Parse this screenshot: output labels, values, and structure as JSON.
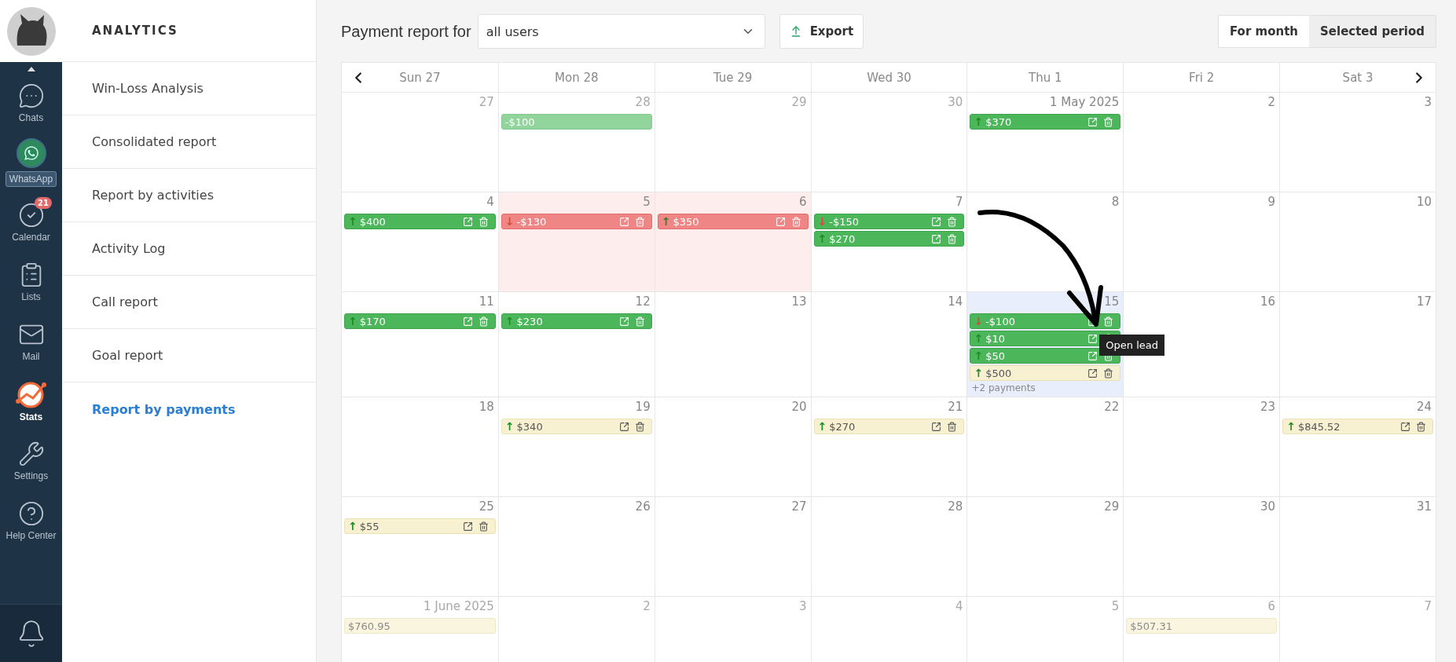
{
  "nav": {
    "items": [
      {
        "kind": "chats",
        "label": "Chats",
        "selected": false
      },
      {
        "kind": "whatsapp",
        "label": "WhatsApp",
        "selected": false
      },
      {
        "kind": "calendar",
        "label": "Calendar",
        "selected": false,
        "badge": "21"
      },
      {
        "kind": "lists",
        "label": "Lists",
        "selected": false
      },
      {
        "kind": "mail",
        "label": "Mail",
        "selected": false
      },
      {
        "kind": "stats",
        "label": "Stats",
        "selected": true
      },
      {
        "kind": "settings",
        "label": "Settings",
        "selected": false
      },
      {
        "kind": "help",
        "label": "Help Center",
        "selected": false
      }
    ]
  },
  "sidebar": {
    "title": "ANALYTICS",
    "items": [
      {
        "label": "Win-Loss Analysis",
        "selected": false
      },
      {
        "label": "Consolidated report",
        "selected": false
      },
      {
        "label": "Report by activities",
        "selected": false
      },
      {
        "label": "Activity Log",
        "selected": false
      },
      {
        "label": "Call report",
        "selected": false
      },
      {
        "label": "Goal report",
        "selected": false
      },
      {
        "label": "Report by payments",
        "selected": true
      }
    ]
  },
  "toolbar": {
    "title": "Payment report for",
    "user_select": "all users",
    "export": "Export",
    "modes": [
      {
        "label": "For month",
        "selected": true
      },
      {
        "label": "Selected period",
        "selected": false
      }
    ]
  },
  "calendar": {
    "days_header": [
      "Sun 27",
      "Mon 28",
      "Tue 29",
      "Wed 30",
      "Thu 1",
      "Fri 2",
      "Sat 3"
    ],
    "weeks": [
      {
        "days": [
          {
            "date": "27",
            "other_month": true,
            "overdue": false,
            "hovered": false
          },
          {
            "date": "28",
            "other_month": true,
            "overdue": false,
            "hovered": false,
            "payments": [
              {
                "kind": "past",
                "amount": "-$100"
              }
            ]
          },
          {
            "date": "29",
            "other_month": true,
            "overdue": false,
            "hovered": false
          },
          {
            "date": "30",
            "other_month": true,
            "overdue": false,
            "hovered": false
          },
          {
            "date": "1 May 2025",
            "other_month": false,
            "overdue": false,
            "hovered": false,
            "payments": [
              {
                "kind": "paid",
                "arrow": "↑",
                "amount": "$370"
              }
            ]
          },
          {
            "date": "2",
            "other_month": false,
            "overdue": false,
            "hovered": false
          },
          {
            "date": "3",
            "other_month": false,
            "overdue": false,
            "hovered": false
          }
        ]
      },
      {
        "days": [
          {
            "date": "4",
            "other_month": false,
            "overdue": false,
            "hovered": false,
            "payments": [
              {
                "kind": "paid",
                "arrow": "↑",
                "amount": "$400"
              }
            ]
          },
          {
            "date": "5",
            "other_month": false,
            "overdue": true,
            "hovered": false,
            "payments": [
              {
                "kind": "overdue",
                "arrow": "↓",
                "amount": "-$130"
              }
            ]
          },
          {
            "date": "6",
            "other_month": false,
            "overdue": true,
            "hovered": false,
            "payments": [
              {
                "kind": "overdue",
                "arrow": "↑",
                "amount": "$350"
              }
            ]
          },
          {
            "date": "7",
            "other_month": false,
            "overdue": false,
            "hovered": false,
            "payments": [
              {
                "kind": "paid",
                "arrow": "↓",
                "amount": "-$150"
              },
              {
                "kind": "paid",
                "arrow": "↑",
                "amount": "$270"
              }
            ]
          },
          {
            "date": "8",
            "other_month": false,
            "overdue": false,
            "hovered": false
          },
          {
            "date": "9",
            "other_month": false,
            "overdue": false,
            "hovered": false
          },
          {
            "date": "10",
            "other_month": false,
            "overdue": false,
            "hovered": false
          }
        ]
      },
      {
        "days": [
          {
            "date": "11",
            "other_month": false,
            "overdue": false,
            "hovered": false,
            "payments": [
              {
                "kind": "paid",
                "arrow": "↑",
                "amount": "$170"
              }
            ]
          },
          {
            "date": "12",
            "other_month": false,
            "overdue": false,
            "hovered": false,
            "payments": [
              {
                "kind": "paid",
                "arrow": "↑",
                "amount": "$230"
              }
            ]
          },
          {
            "date": "13",
            "other_month": false,
            "overdue": false,
            "hovered": false
          },
          {
            "date": "14",
            "other_month": false,
            "overdue": false,
            "hovered": false
          },
          {
            "date": "15",
            "other_month": false,
            "overdue": false,
            "hovered": true,
            "payments": [
              {
                "kind": "paid",
                "arrow": "↓",
                "amount": "-$100"
              },
              {
                "kind": "paid",
                "arrow": "↑",
                "amount": "$10",
                "tooltip": "Open lead"
              },
              {
                "kind": "paid",
                "arrow": "↑",
                "amount": "$50"
              },
              {
                "kind": "pending",
                "arrow": "↑",
                "amount": "$500"
              }
            ],
            "more": "+2 payments"
          },
          {
            "date": "16",
            "other_month": false,
            "overdue": false,
            "hovered": false
          },
          {
            "date": "17",
            "other_month": false,
            "overdue": false,
            "hovered": false
          }
        ]
      },
      {
        "days": [
          {
            "date": "18",
            "other_month": false,
            "overdue": false,
            "hovered": false
          },
          {
            "date": "19",
            "other_month": false,
            "overdue": false,
            "hovered": false,
            "payments": [
              {
                "kind": "pending",
                "arrow": "↑",
                "amount": "$340"
              }
            ]
          },
          {
            "date": "20",
            "other_month": false,
            "overdue": false,
            "hovered": false
          },
          {
            "date": "21",
            "other_month": false,
            "overdue": false,
            "hovered": false,
            "payments": [
              {
                "kind": "pending",
                "arrow": "↑",
                "amount": "$270"
              }
            ]
          },
          {
            "date": "22",
            "other_month": false,
            "overdue": false,
            "hovered": false
          },
          {
            "date": "23",
            "other_month": false,
            "overdue": false,
            "hovered": false
          },
          {
            "date": "24",
            "other_month": false,
            "overdue": false,
            "hovered": false,
            "payments": [
              {
                "kind": "pending",
                "arrow": "↑",
                "amount": "$845.52"
              }
            ]
          }
        ]
      },
      {
        "days": [
          {
            "date": "25",
            "other_month": false,
            "overdue": false,
            "hovered": false,
            "payments": [
              {
                "kind": "pending",
                "arrow": "↑",
                "amount": "$55"
              }
            ]
          },
          {
            "date": "26",
            "other_month": false,
            "overdue": false,
            "hovered": false
          },
          {
            "date": "27",
            "other_month": false,
            "overdue": false,
            "hovered": false
          },
          {
            "date": "28",
            "other_month": false,
            "overdue": false,
            "hovered": false
          },
          {
            "date": "29",
            "other_month": false,
            "overdue": false,
            "hovered": false
          },
          {
            "date": "30",
            "other_month": false,
            "overdue": false,
            "hovered": false
          },
          {
            "date": "31",
            "other_month": false,
            "overdue": false,
            "hovered": false
          }
        ]
      },
      {
        "days": [
          {
            "date": "1 June 2025",
            "other_month": true,
            "overdue": false,
            "hovered": false,
            "payments": [
              {
                "kind": "forecast",
                "amount": "$760.95"
              }
            ]
          },
          {
            "date": "2",
            "other_month": true,
            "overdue": false,
            "hovered": false
          },
          {
            "date": "3",
            "other_month": true,
            "overdue": false,
            "hovered": false
          },
          {
            "date": "4",
            "other_month": true,
            "overdue": false,
            "hovered": false
          },
          {
            "date": "5",
            "other_month": true,
            "overdue": false,
            "hovered": false
          },
          {
            "date": "6",
            "other_month": true,
            "overdue": false,
            "hovered": false,
            "payments": [
              {
                "kind": "forecast",
                "amount": "$507.31"
              }
            ]
          },
          {
            "date": "7",
            "other_month": true,
            "overdue": false,
            "hovered": false
          }
        ]
      }
    ]
  }
}
